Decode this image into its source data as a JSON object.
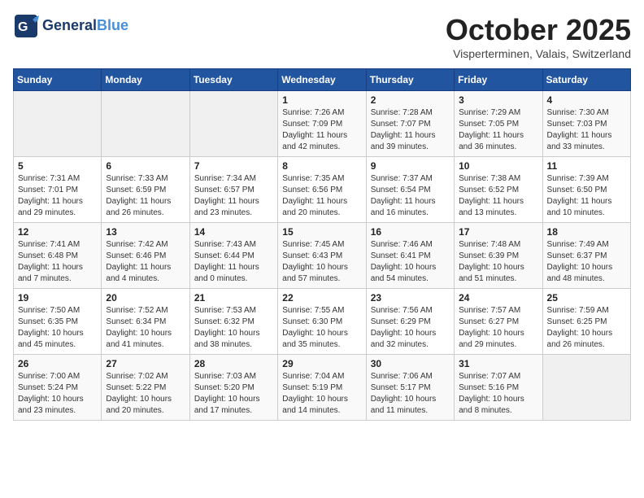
{
  "header": {
    "logo_general": "General",
    "logo_blue": "Blue",
    "month": "October 2025",
    "location": "Visperterminen, Valais, Switzerland"
  },
  "weekdays": [
    "Sunday",
    "Monday",
    "Tuesday",
    "Wednesday",
    "Thursday",
    "Friday",
    "Saturday"
  ],
  "weeks": [
    [
      {
        "day": "",
        "info": ""
      },
      {
        "day": "",
        "info": ""
      },
      {
        "day": "",
        "info": ""
      },
      {
        "day": "1",
        "info": "Sunrise: 7:26 AM\nSunset: 7:09 PM\nDaylight: 11 hours\nand 42 minutes."
      },
      {
        "day": "2",
        "info": "Sunrise: 7:28 AM\nSunset: 7:07 PM\nDaylight: 11 hours\nand 39 minutes."
      },
      {
        "day": "3",
        "info": "Sunrise: 7:29 AM\nSunset: 7:05 PM\nDaylight: 11 hours\nand 36 minutes."
      },
      {
        "day": "4",
        "info": "Sunrise: 7:30 AM\nSunset: 7:03 PM\nDaylight: 11 hours\nand 33 minutes."
      }
    ],
    [
      {
        "day": "5",
        "info": "Sunrise: 7:31 AM\nSunset: 7:01 PM\nDaylight: 11 hours\nand 29 minutes."
      },
      {
        "day": "6",
        "info": "Sunrise: 7:33 AM\nSunset: 6:59 PM\nDaylight: 11 hours\nand 26 minutes."
      },
      {
        "day": "7",
        "info": "Sunrise: 7:34 AM\nSunset: 6:57 PM\nDaylight: 11 hours\nand 23 minutes."
      },
      {
        "day": "8",
        "info": "Sunrise: 7:35 AM\nSunset: 6:56 PM\nDaylight: 11 hours\nand 20 minutes."
      },
      {
        "day": "9",
        "info": "Sunrise: 7:37 AM\nSunset: 6:54 PM\nDaylight: 11 hours\nand 16 minutes."
      },
      {
        "day": "10",
        "info": "Sunrise: 7:38 AM\nSunset: 6:52 PM\nDaylight: 11 hours\nand 13 minutes."
      },
      {
        "day": "11",
        "info": "Sunrise: 7:39 AM\nSunset: 6:50 PM\nDaylight: 11 hours\nand 10 minutes."
      }
    ],
    [
      {
        "day": "12",
        "info": "Sunrise: 7:41 AM\nSunset: 6:48 PM\nDaylight: 11 hours\nand 7 minutes."
      },
      {
        "day": "13",
        "info": "Sunrise: 7:42 AM\nSunset: 6:46 PM\nDaylight: 11 hours\nand 4 minutes."
      },
      {
        "day": "14",
        "info": "Sunrise: 7:43 AM\nSunset: 6:44 PM\nDaylight: 11 hours\nand 0 minutes."
      },
      {
        "day": "15",
        "info": "Sunrise: 7:45 AM\nSunset: 6:43 PM\nDaylight: 10 hours\nand 57 minutes."
      },
      {
        "day": "16",
        "info": "Sunrise: 7:46 AM\nSunset: 6:41 PM\nDaylight: 10 hours\nand 54 minutes."
      },
      {
        "day": "17",
        "info": "Sunrise: 7:48 AM\nSunset: 6:39 PM\nDaylight: 10 hours\nand 51 minutes."
      },
      {
        "day": "18",
        "info": "Sunrise: 7:49 AM\nSunset: 6:37 PM\nDaylight: 10 hours\nand 48 minutes."
      }
    ],
    [
      {
        "day": "19",
        "info": "Sunrise: 7:50 AM\nSunset: 6:35 PM\nDaylight: 10 hours\nand 45 minutes."
      },
      {
        "day": "20",
        "info": "Sunrise: 7:52 AM\nSunset: 6:34 PM\nDaylight: 10 hours\nand 41 minutes."
      },
      {
        "day": "21",
        "info": "Sunrise: 7:53 AM\nSunset: 6:32 PM\nDaylight: 10 hours\nand 38 minutes."
      },
      {
        "day": "22",
        "info": "Sunrise: 7:55 AM\nSunset: 6:30 PM\nDaylight: 10 hours\nand 35 minutes."
      },
      {
        "day": "23",
        "info": "Sunrise: 7:56 AM\nSunset: 6:29 PM\nDaylight: 10 hours\nand 32 minutes."
      },
      {
        "day": "24",
        "info": "Sunrise: 7:57 AM\nSunset: 6:27 PM\nDaylight: 10 hours\nand 29 minutes."
      },
      {
        "day": "25",
        "info": "Sunrise: 7:59 AM\nSunset: 6:25 PM\nDaylight: 10 hours\nand 26 minutes."
      }
    ],
    [
      {
        "day": "26",
        "info": "Sunrise: 7:00 AM\nSunset: 5:24 PM\nDaylight: 10 hours\nand 23 minutes."
      },
      {
        "day": "27",
        "info": "Sunrise: 7:02 AM\nSunset: 5:22 PM\nDaylight: 10 hours\nand 20 minutes."
      },
      {
        "day": "28",
        "info": "Sunrise: 7:03 AM\nSunset: 5:20 PM\nDaylight: 10 hours\nand 17 minutes."
      },
      {
        "day": "29",
        "info": "Sunrise: 7:04 AM\nSunset: 5:19 PM\nDaylight: 10 hours\nand 14 minutes."
      },
      {
        "day": "30",
        "info": "Sunrise: 7:06 AM\nSunset: 5:17 PM\nDaylight: 10 hours\nand 11 minutes."
      },
      {
        "day": "31",
        "info": "Sunrise: 7:07 AM\nSunset: 5:16 PM\nDaylight: 10 hours\nand 8 minutes."
      },
      {
        "day": "",
        "info": ""
      }
    ]
  ]
}
